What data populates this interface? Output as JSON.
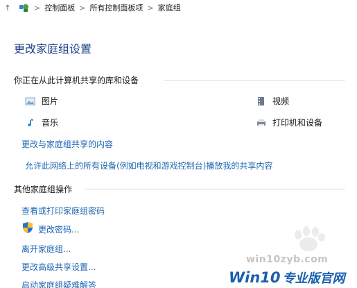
{
  "breadcrumb": {
    "up_glyph": "↑",
    "separator": ">",
    "segments": [
      "控制面板",
      "所有控制面板项",
      "家庭组"
    ]
  },
  "page_title": "更改家庭组设置",
  "shared_section": {
    "heading": "你正在从此计算机共享的库和设备",
    "items": [
      {
        "label": "图片",
        "icon": "pictures-icon"
      },
      {
        "label": "视频",
        "icon": "videos-icon"
      },
      {
        "label": "音乐",
        "icon": "music-icon"
      },
      {
        "label": "打印机和设备",
        "icon": "printer-icon"
      }
    ],
    "links": [
      "更改与家庭组共享的内容",
      "允许此网络上的所有设备(例如电视和游戏控制台)播放我的共享内容"
    ]
  },
  "other_section": {
    "heading": "其他家庭组操作",
    "links": [
      "查看或打印家庭组密码",
      "更改密码...",
      "离开家庭组...",
      "更改高级共享设置...",
      "启动家庭组疑难解答"
    ]
  },
  "watermark": {
    "site": "win10zyb.com",
    "brand": "Win10",
    "brand_suffix": "专业版官网"
  },
  "colors": {
    "title": "#1e3f87",
    "link": "#1f66b3",
    "watermark_brand": "#1a5fb0"
  }
}
